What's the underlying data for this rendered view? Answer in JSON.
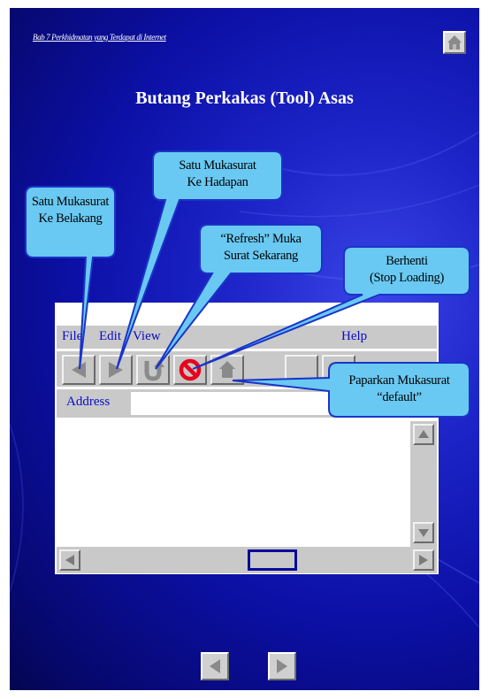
{
  "page": {
    "breadcrumb": "Bab 7 Perkhidmatan yang Terdapat di Internet",
    "title": "Butang Perkakas (Tool) Asas"
  },
  "browser": {
    "menu": {
      "file": "File",
      "edit": "Edit",
      "view": "View",
      "help": "Help"
    },
    "address_label": "Address",
    "address_value": ""
  },
  "callouts": {
    "back": [
      "Satu Mukasurat",
      "Ke Belakang"
    ],
    "forward": [
      "Satu Mukasurat",
      "Ke Hadapan"
    ],
    "refresh": [
      "“Refresh” Muka",
      "Surat Sekarang"
    ],
    "stop": [
      "Berhenti",
      "(Stop Loading)"
    ],
    "home": [
      "Paparkan Mukasurat",
      "“default”"
    ]
  },
  "icons": {
    "home": "home-icon",
    "back": "back-arrow-icon",
    "forward": "forward-arrow-icon",
    "refresh": "refresh-u-turn-icon",
    "stop": "stop-prohibited-icon",
    "scroll_up": "scroll-up-arrow-icon",
    "scroll_down": "scroll-down-arrow-icon",
    "scroll_left": "scroll-left-arrow-icon",
    "scroll_right": "scroll-right-arrow-icon"
  },
  "colors": {
    "slide_background": "#0c10a6",
    "callout_fill": "#69c9f2",
    "callout_border": "#1a34c8",
    "stop_red": "#e8001c",
    "menu_text": "#0a0ac8"
  }
}
